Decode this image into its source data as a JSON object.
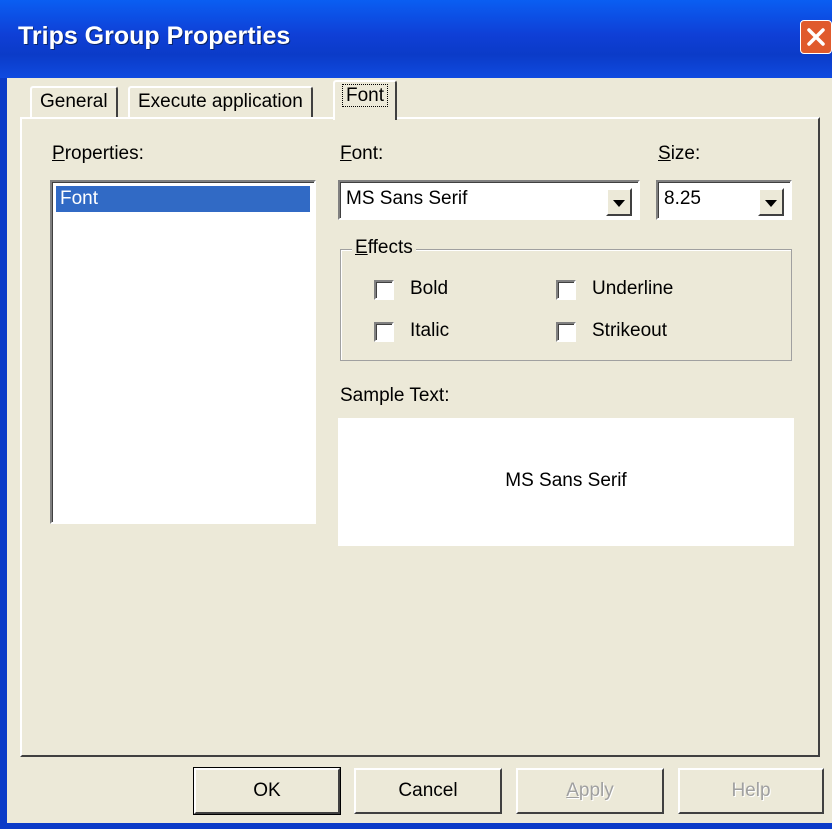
{
  "window": {
    "title": "Trips Group Properties",
    "close_icon": "close-icon"
  },
  "tabs": [
    {
      "label": "General",
      "active": false
    },
    {
      "label": "Execute application",
      "active": false
    },
    {
      "label": "Font",
      "active": true
    }
  ],
  "properties": {
    "label_accel": "P",
    "label_rest": "roperties:",
    "items": [
      "Font"
    ],
    "selected": "Font"
  },
  "font": {
    "label_accel": "F",
    "label_rest": "ont:",
    "value": "MS Sans Serif"
  },
  "size": {
    "label_accel": "S",
    "label_rest": "ize:",
    "value": "8.25"
  },
  "effects": {
    "label_accel": "E",
    "label_rest": "ffects",
    "bold": {
      "label": "Bold",
      "checked": false
    },
    "underline": {
      "label": "Underline",
      "checked": false
    },
    "italic": {
      "label": "Italic",
      "checked": false
    },
    "strikeout": {
      "label": "Strikeout",
      "checked": false
    }
  },
  "sample": {
    "label": "Sample Text:",
    "text": "MS Sans Serif"
  },
  "buttons": {
    "ok": "OK",
    "cancel": "Cancel",
    "apply_accel": "A",
    "apply_rest": "pply",
    "help": "Help"
  }
}
